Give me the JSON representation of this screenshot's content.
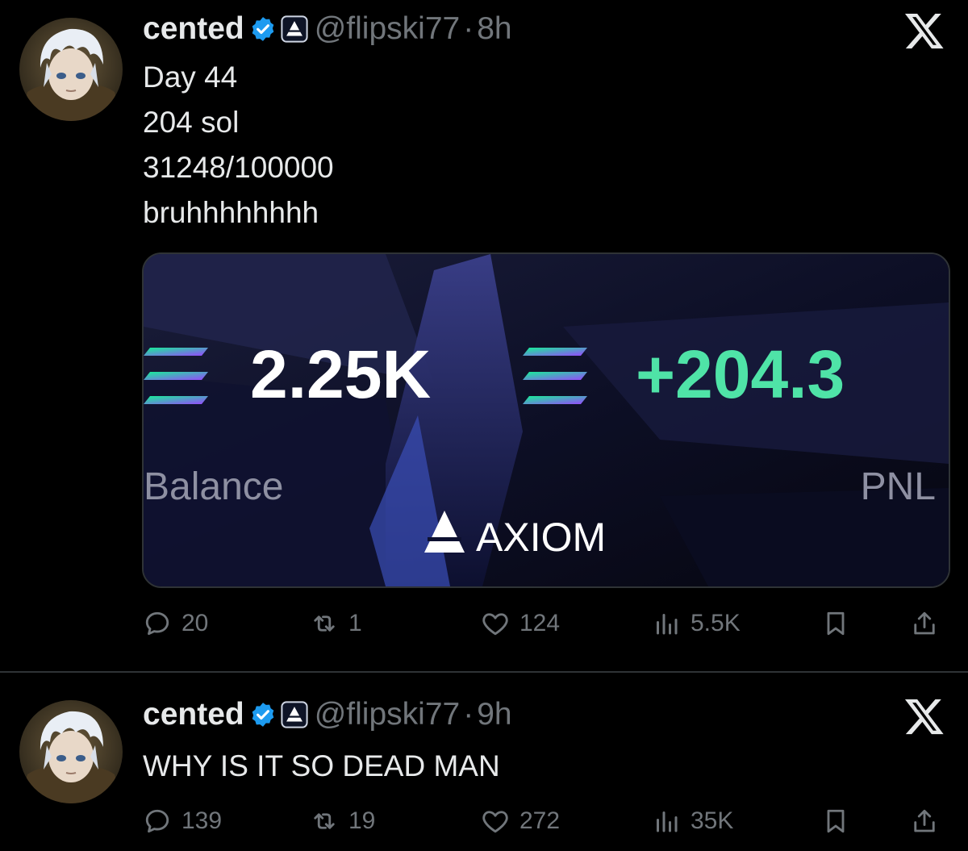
{
  "tweets": [
    {
      "name": "cented",
      "handle": "@flipski77",
      "dot": "·",
      "time": "8h",
      "lines": [
        "Day 44",
        "204 sol",
        "31248/100000",
        "bruhhhhhhhh"
      ],
      "media": {
        "balance_value": "2.25K",
        "balance_label": "Balance",
        "pnl_value": "+204.3",
        "pnl_label": "PNL",
        "brand": "AXIOM"
      },
      "stats": {
        "replies": "20",
        "reposts": "1",
        "likes": "124",
        "views": "5.5K"
      }
    },
    {
      "name": "cented",
      "handle": "@flipski77",
      "dot": "·",
      "time": "9h",
      "lines": [
        "WHY IS IT SO DEAD MAN"
      ],
      "stats": {
        "replies": "139",
        "reposts": "19",
        "likes": "272",
        "views": "35K"
      }
    }
  ],
  "colors": {
    "background": "#000000",
    "text": "#e7e9ea",
    "muted": "#71767b",
    "verified": "#1d9bf0",
    "pnl_green": "#4fe3a7",
    "divider": "#2f3336"
  },
  "icons": {
    "reply": "reply-icon",
    "repost": "repost-icon",
    "like": "heart-icon",
    "views": "views-icon",
    "bookmark": "bookmark-icon",
    "share": "share-icon",
    "more": "x-logo-icon"
  }
}
